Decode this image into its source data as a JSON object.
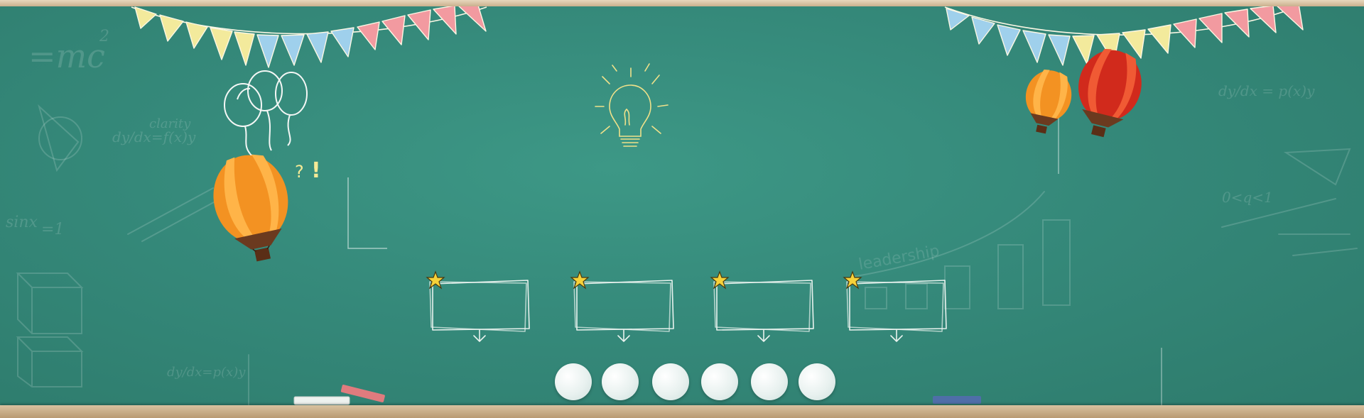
{
  "chalk_notes": {
    "formula_emc2": "=mc",
    "derivative_left": "dy/dx=f(x)y",
    "clarity": "clarity",
    "sinx": "sinx",
    "sinx_rhs": "=1",
    "leadership": "leadership",
    "derivative_right": "dy/dx = p(x)y",
    "inequality": "0<q<1",
    "derivative_bottom": "dy/dx=p(x)y"
  },
  "colors": {
    "board": "#35897a",
    "frame": "#d4bb97",
    "flag_yellow": "#f3ea9c",
    "flag_blue": "#9fd0ec",
    "flag_pink": "#f29aa0",
    "balloon_orange": "#f39222",
    "balloon_red": "#d12a1c",
    "star": "#f6d23a",
    "bulb": "#f0e38a"
  },
  "content_boxes": [
    {
      "id": "box-1"
    },
    {
      "id": "box-2"
    },
    {
      "id": "box-3"
    },
    {
      "id": "box-4"
    }
  ],
  "circle_buttons": [
    {
      "id": "c1"
    },
    {
      "id": "c2"
    },
    {
      "id": "c3"
    },
    {
      "id": "c4"
    },
    {
      "id": "c5"
    },
    {
      "id": "c6"
    }
  ]
}
